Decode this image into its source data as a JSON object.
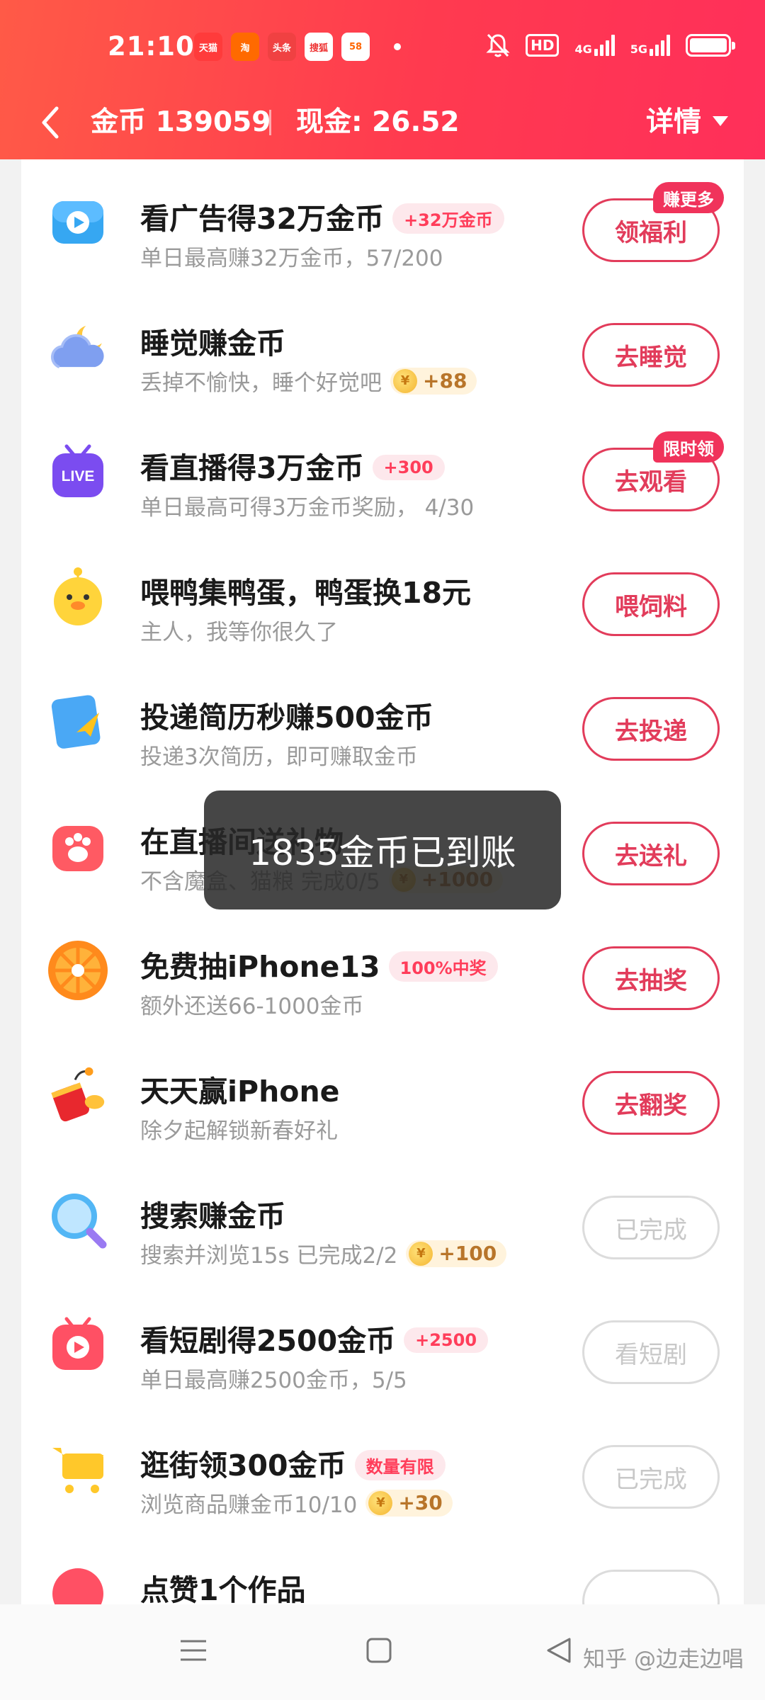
{
  "status_bar": {
    "time": "21:10",
    "app_icons": [
      {
        "name": "tmall-icon",
        "text": "天猫",
        "bg": "#ff3b3b",
        "fg": "#fff"
      },
      {
        "name": "taobao-icon",
        "text": "淘",
        "bg": "#ff6a00",
        "fg": "#fff"
      },
      {
        "name": "toutiao-icon",
        "text": "头条",
        "bg": "#f04142",
        "fg": "#fff"
      },
      {
        "name": "sogou-icon",
        "text": "搜狐",
        "bg": "#ffffff",
        "fg": "#e33"
      },
      {
        "name": "58-icon",
        "text": "58",
        "bg": "#ffffff",
        "fg": "#f60"
      }
    ],
    "hd": "HD",
    "net1": "4G",
    "net2": "5G"
  },
  "header": {
    "coins": "金币 139059",
    "cash": "现金: 26.52",
    "detail": "详情"
  },
  "tasks": [
    {
      "title": "看广告得32万金币",
      "badge": "+32万金币",
      "sub": "单日最高赚32万金币，57/200",
      "button": "领福利",
      "tag": "赚更多",
      "done": false,
      "icon": "video-icon"
    },
    {
      "title": "睡觉赚金币",
      "sub": "丢掉不愉快，睡个好觉吧",
      "coin_reward": "+88",
      "button": "去睡觉",
      "done": false,
      "icon": "cloud-moon-icon"
    },
    {
      "title": "看直播得3万金币",
      "badge": "+300",
      "sub": "单日最高可得3万金币奖励， 4/30",
      "button": "去观看",
      "tag": "限时领",
      "done": false,
      "icon": "live-tv-icon",
      "icon_text": "LIVE"
    },
    {
      "title": "喂鸭集鸭蛋，鸭蛋换18元",
      "sub": "主人，我等你很久了",
      "button": "喂饲料",
      "done": false,
      "icon": "duck-icon"
    },
    {
      "title": "投递简历秒赚500金币",
      "sub": "投递3次简历，即可赚取金币",
      "button": "去投递",
      "done": false,
      "icon": "resume-icon"
    },
    {
      "title": "在直播间送礼物",
      "sub": "不含魔盒、猫粮 完成0/5",
      "coin_reward": "+1000",
      "button": "去送礼",
      "done": false,
      "icon": "gift-icon"
    },
    {
      "title": "免费抽iPhone13",
      "badge": "100%中奖",
      "sub": "额外还送66-1000金币",
      "button": "去抽奖",
      "done": false,
      "icon": "wheel-icon"
    },
    {
      "title": "天天赢iPhone",
      "sub": "除夕起解锁新春好礼",
      "button": "去翻奖",
      "done": false,
      "icon": "firecracker-icon"
    },
    {
      "title": "搜索赚金币",
      "sub": "搜索并浏览15s 已完成2/2",
      "coin_reward": "+100",
      "button": "已完成",
      "done": true,
      "icon": "search-icon"
    },
    {
      "title": "看短剧得2500金币",
      "badge": "+2500",
      "sub": "单日最高赚2500金币，5/5",
      "button": "看短剧",
      "done": true,
      "icon": "drama-icon"
    },
    {
      "title": "逛街领300金币",
      "badge": "数量有限",
      "sub": "浏览商品赚金币10/10",
      "coin_reward": "+30",
      "button": "已完成",
      "done": true,
      "icon": "cart-icon"
    },
    {
      "title": "点赞1个作品",
      "sub": "",
      "button": "",
      "done": true,
      "icon": "like-icon"
    }
  ],
  "toast": "1835金币已到账",
  "watermark": "知乎 @边走边唱",
  "colors": {
    "accent": "#ff3a4f",
    "button": "#e23c5b",
    "done": "#c8c8c8"
  }
}
